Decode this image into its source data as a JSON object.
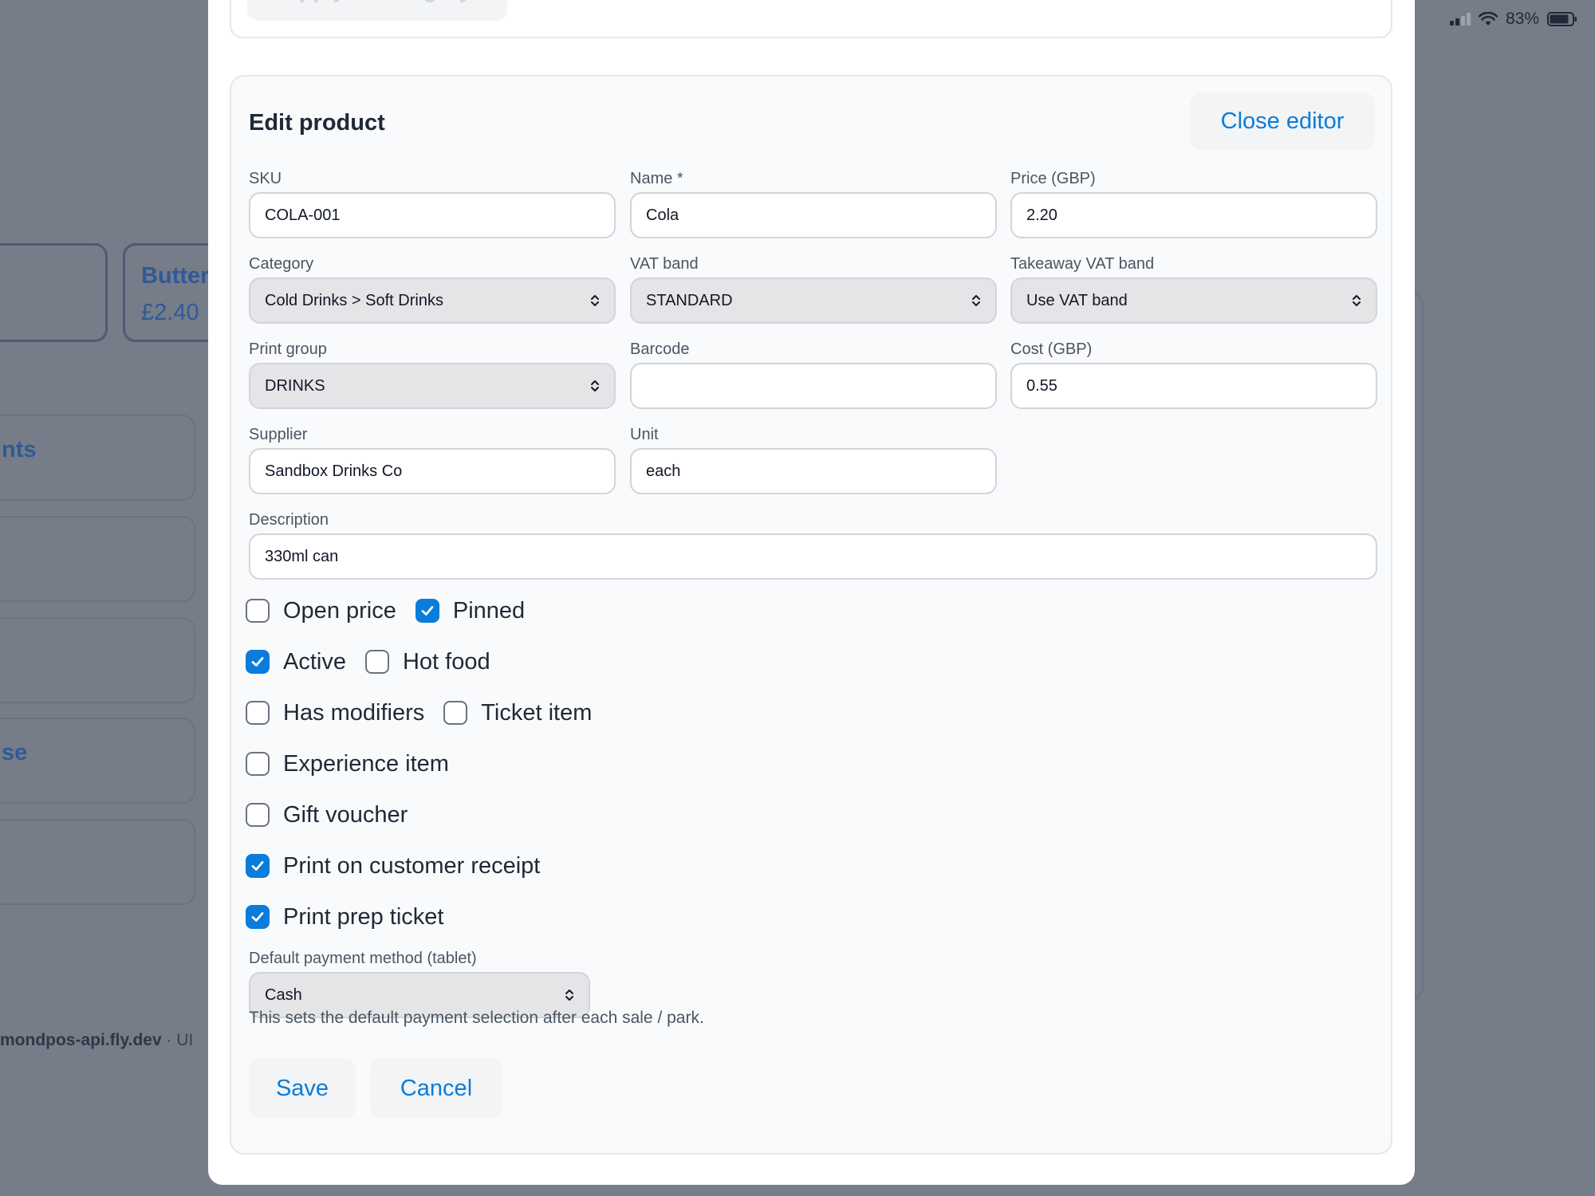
{
  "status_bar": {
    "battery_label": "83%"
  },
  "background": {
    "tile_name": "Butter",
    "tile_price": "£2.40",
    "card_fragment_1": "nts",
    "card_fragment_2": "se",
    "footer_host": "mondpos-api.fly.dev",
    "footer_tail": " · UI"
  },
  "top_card": {
    "apply_label": "Apply to category"
  },
  "editor": {
    "title": "Edit product",
    "close_label": "Close editor",
    "fields": {
      "sku": {
        "label": "SKU",
        "value": "COLA-001"
      },
      "name": {
        "label": "Name *",
        "value": "Cola"
      },
      "price": {
        "label": "Price (GBP)",
        "value": "2.20"
      },
      "category": {
        "label": "Category",
        "value": "Cold Drinks > Soft Drinks"
      },
      "vat_band": {
        "label": "VAT band",
        "value": "STANDARD"
      },
      "takeaway_vat": {
        "label": "Takeaway VAT band",
        "value": "Use VAT band"
      },
      "print_group": {
        "label": "Print group",
        "value": "DRINKS"
      },
      "barcode": {
        "label": "Barcode",
        "value": ""
      },
      "cost": {
        "label": "Cost (GBP)",
        "value": "0.55"
      },
      "supplier": {
        "label": "Supplier",
        "value": "Sandbox Drinks Co"
      },
      "unit": {
        "label": "Unit",
        "value": "each"
      },
      "description": {
        "label": "Description",
        "value": "330ml can"
      }
    },
    "checkboxes": {
      "open_price": {
        "label": "Open price",
        "checked": false
      },
      "pinned": {
        "label": "Pinned",
        "checked": true
      },
      "active": {
        "label": "Active",
        "checked": true
      },
      "hot_food": {
        "label": "Hot food",
        "checked": false
      },
      "has_modifiers": {
        "label": "Has modifiers",
        "checked": false
      },
      "ticket_item": {
        "label": "Ticket item",
        "checked": false
      },
      "experience_item": {
        "label": "Experience item",
        "checked": false
      },
      "gift_voucher": {
        "label": "Gift voucher",
        "checked": false
      },
      "print_receipt": {
        "label": "Print on customer receipt",
        "checked": true
      },
      "print_prep": {
        "label": "Print prep ticket",
        "checked": true
      }
    },
    "payment": {
      "label": "Default payment method (tablet)",
      "value": "Cash",
      "hint": "This sets the default payment selection after each sale / park."
    },
    "save_label": "Save",
    "cancel_label": "Cancel"
  },
  "colors": {
    "accent": "#0a7cdb",
    "overlay": "#767c88",
    "panel": "#f9fafb"
  }
}
